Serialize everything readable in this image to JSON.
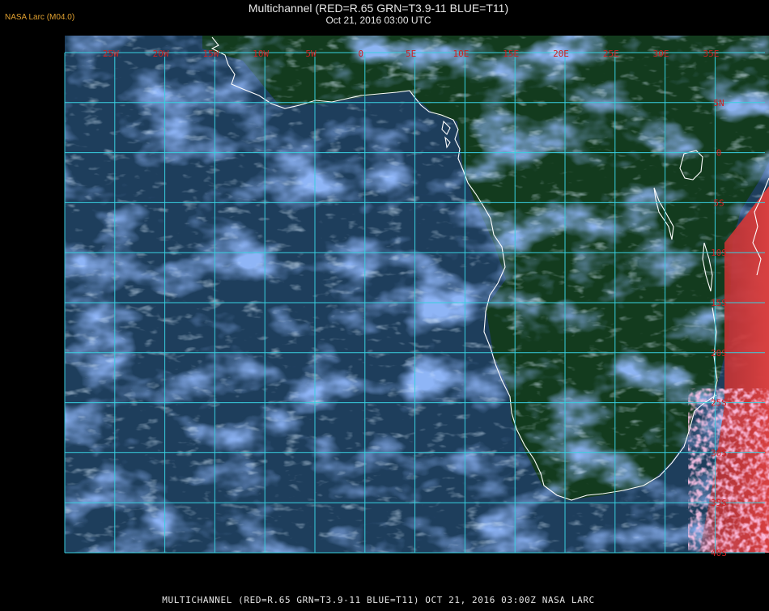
{
  "header": {
    "badge": "NASA Larc (M04.0)",
    "title": "Multichannel (RED=R.65 GRN=T3.9-11 BLUE=T11)",
    "subtitle": "Oct 21, 2016 03:00 UTC"
  },
  "footer": {
    "caption": "MULTICHANNEL (RED=R.65 GRN=T3.9-11 BLUE=T11) OCT 21, 2016 03:00Z   NASA LARC"
  },
  "map": {
    "lon_labels": [
      "25W",
      "20W",
      "15W",
      "10W",
      "5W",
      "0",
      "5E",
      "10E",
      "15E",
      "20E",
      "25E",
      "30E",
      "35E"
    ],
    "lat_labels": [
      "5N",
      "0",
      "5S",
      "10S",
      "15S",
      "20S",
      "25S",
      "30S",
      "35S",
      "40S"
    ],
    "colors": {
      "grid": "#38d0e0",
      "label": "#d02020",
      "coast": "#ffffff",
      "ocean": "#1d3d5a",
      "land": "#123a1c",
      "cloud": "#3a6ee6"
    }
  }
}
